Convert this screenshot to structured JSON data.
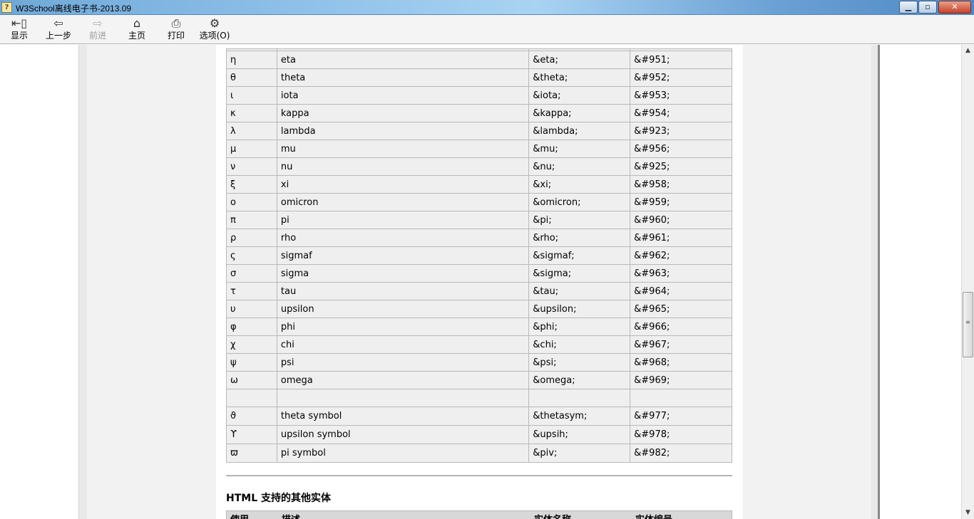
{
  "window": {
    "title": "W3School离线电子书-2013.09",
    "minimize_label": "0",
    "maximize_label": "1",
    "close_label": "r"
  },
  "toolbar": {
    "buttons": [
      {
        "label": "显示",
        "icon": "show-panel-icon",
        "glyph": "⇤▯",
        "enabled": true
      },
      {
        "label": "上一步",
        "icon": "back-arrow-icon",
        "glyph": "⇦",
        "enabled": true
      },
      {
        "label": "前进",
        "icon": "forward-arrow-icon",
        "glyph": "⇨",
        "enabled": false
      },
      {
        "label": "主页",
        "icon": "home-icon",
        "glyph": "⌂",
        "enabled": true
      },
      {
        "label": "打印",
        "icon": "printer-icon",
        "glyph": "⎙",
        "enabled": true
      },
      {
        "label": "选项(O)",
        "icon": "options-icon",
        "glyph": "⚙",
        "enabled": true
      }
    ]
  },
  "entity_table": {
    "rows": [
      {
        "char": "η",
        "desc": "eta",
        "name": "&eta;",
        "number": "&#951;"
      },
      {
        "char": "θ",
        "desc": "theta",
        "name": "&theta;",
        "number": "&#952;"
      },
      {
        "char": "ι",
        "desc": "iota",
        "name": "&iota;",
        "number": "&#953;"
      },
      {
        "char": "κ",
        "desc": "kappa",
        "name": "&kappa;",
        "number": "&#954;"
      },
      {
        "char": "λ",
        "desc": "lambda",
        "name": "&lambda;",
        "number": "&#923;"
      },
      {
        "char": "μ",
        "desc": "mu",
        "name": "&mu;",
        "number": "&#956;"
      },
      {
        "char": "ν",
        "desc": "nu",
        "name": "&nu;",
        "number": "&#925;"
      },
      {
        "char": "ξ",
        "desc": "xi",
        "name": "&xi;",
        "number": "&#958;"
      },
      {
        "char": "ο",
        "desc": "omicron",
        "name": "&omicron;",
        "number": "&#959;"
      },
      {
        "char": "π",
        "desc": "pi",
        "name": "&pi;",
        "number": "&#960;"
      },
      {
        "char": "ρ",
        "desc": "rho",
        "name": "&rho;",
        "number": "&#961;"
      },
      {
        "char": "ς",
        "desc": "sigmaf",
        "name": "&sigmaf;",
        "number": "&#962;"
      },
      {
        "char": "σ",
        "desc": "sigma",
        "name": "&sigma;",
        "number": "&#963;"
      },
      {
        "char": "τ",
        "desc": "tau",
        "name": "&tau;",
        "number": "&#964;"
      },
      {
        "char": "υ",
        "desc": "upsilon",
        "name": "&upsilon;",
        "number": "&#965;"
      },
      {
        "char": "φ",
        "desc": "phi",
        "name": "&phi;",
        "number": "&#966;"
      },
      {
        "char": "χ",
        "desc": "chi",
        "name": "&chi;",
        "number": "&#967;"
      },
      {
        "char": "ψ",
        "desc": "psi",
        "name": "&psi;",
        "number": "&#968;"
      },
      {
        "char": "ω",
        "desc": "omega",
        "name": "&omega;",
        "number": "&#969;"
      },
      {
        "char": "",
        "desc": "",
        "name": "",
        "number": ""
      },
      {
        "char": "ϑ",
        "desc": "theta symbol",
        "name": "&thetasym;",
        "number": "&#977;"
      },
      {
        "char": "ϒ",
        "desc": "upsilon symbol",
        "name": "&upsih;",
        "number": "&#978;"
      },
      {
        "char": "ϖ",
        "desc": "pi symbol",
        "name": "&piv;",
        "number": "&#982;"
      }
    ]
  },
  "section": {
    "heading": "HTML 支持的其他实体",
    "next_headers": [
      "使用",
      "描述",
      "实体名称",
      "实体编号"
    ]
  },
  "scrollbar": {
    "position_fraction": 0.58
  }
}
